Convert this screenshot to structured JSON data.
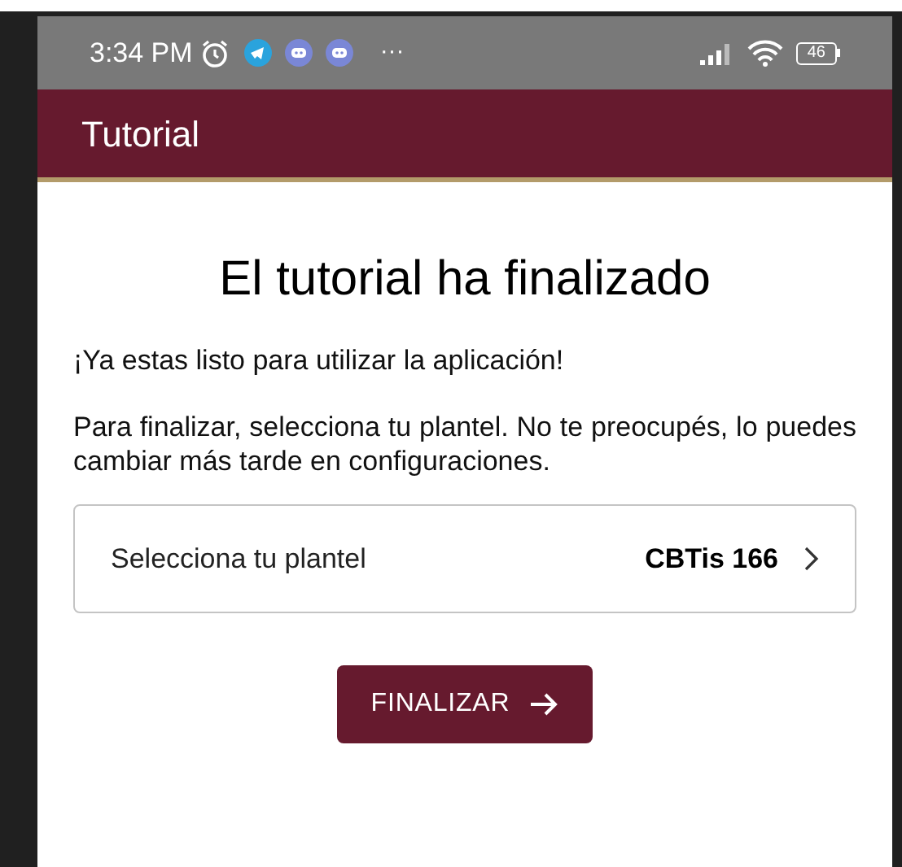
{
  "status_bar": {
    "time": "3:34 PM",
    "more": "···",
    "battery": "46"
  },
  "app_bar": {
    "title": "Tutorial"
  },
  "content": {
    "heading": "El tutorial ha finalizado",
    "paragraphs": [
      "¡Ya estas listo para utilizar la aplicación!",
      "Para finalizar, selecciona tu plantel. No te preocupés, lo puedes cambiar más tarde en configuraciones."
    ],
    "selector": {
      "label": "Selecciona tu plantel",
      "value": "CBTis 166"
    },
    "button": {
      "label": "FINALIZAR"
    }
  }
}
